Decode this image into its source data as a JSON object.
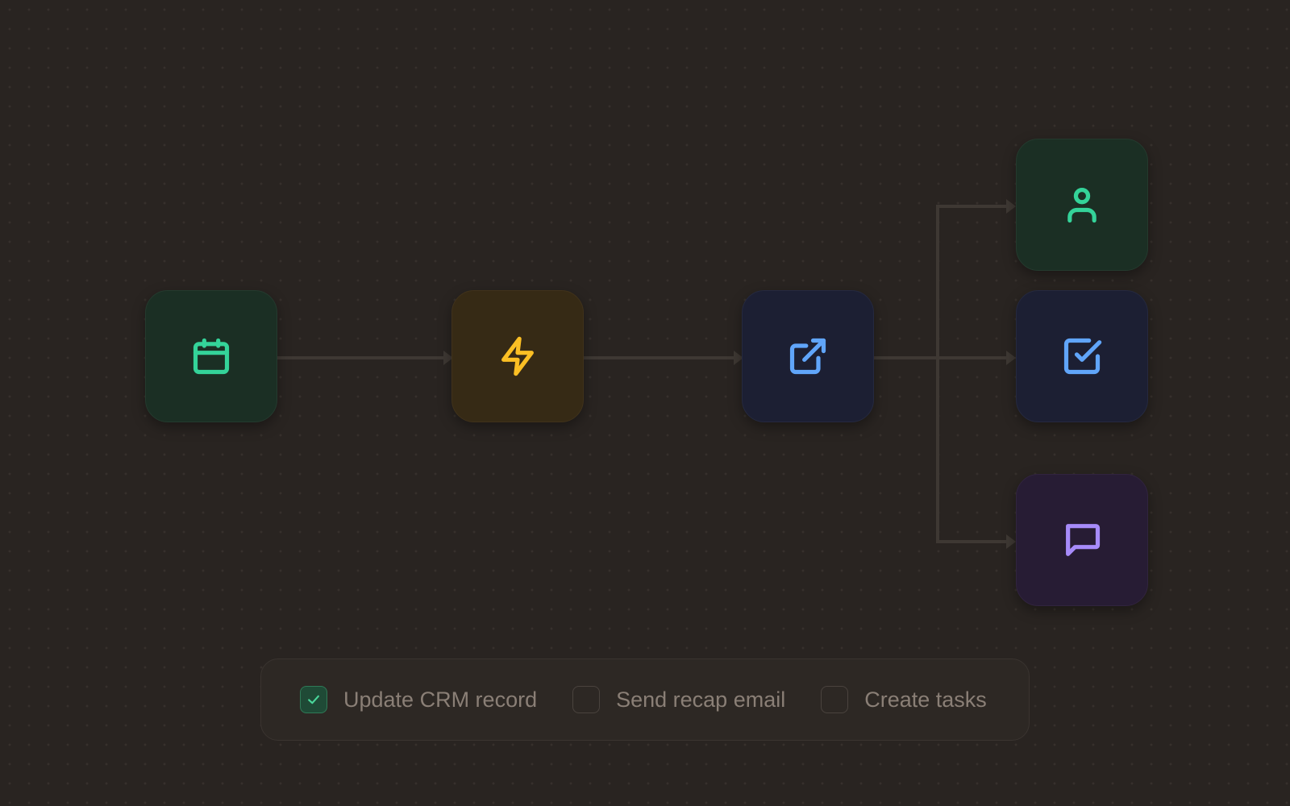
{
  "workflow": {
    "nodes": [
      {
        "id": "trigger",
        "icon": "calendar-icon",
        "color": "#34d399",
        "bg": "#1b2f24"
      },
      {
        "id": "process",
        "icon": "lightning-bolt-icon",
        "color": "#fbbf24",
        "bg": "#362a15"
      },
      {
        "id": "export",
        "icon": "external-link-icon",
        "color": "#60a5fa",
        "bg": "#1c1f33"
      },
      {
        "id": "crm",
        "icon": "user-icon",
        "color": "#34d399",
        "bg": "#1b2f24"
      },
      {
        "id": "tasks",
        "icon": "checkbox-icon",
        "color": "#60a5fa",
        "bg": "#1c1f33"
      },
      {
        "id": "email",
        "icon": "message-icon",
        "color": "#a78bfa",
        "bg": "#271c34"
      }
    ],
    "edge_color": "#3e3833"
  },
  "options": [
    {
      "label": "Update CRM record",
      "checked": true
    },
    {
      "label": "Send recap email",
      "checked": false
    },
    {
      "label": "Create tasks",
      "checked": false
    }
  ]
}
